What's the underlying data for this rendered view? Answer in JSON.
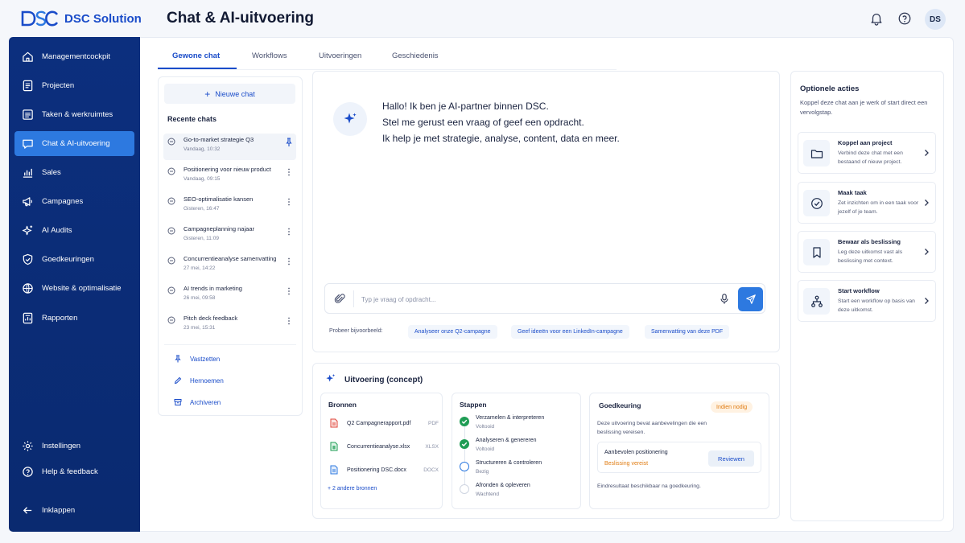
{
  "brand": {
    "logo_text": "DSC Solution",
    "accent": "#1a4cc9",
    "sidebar_bg": "#0c2f7e",
    "active_bg": "#2d79e0"
  },
  "header": {
    "title": "Chat & AI-uitvoering",
    "avatar_initials": "DS"
  },
  "sidebar": {
    "items": [
      {
        "label": "Managementcockpit",
        "icon": "home-icon"
      },
      {
        "label": "Projecten",
        "icon": "document-icon"
      },
      {
        "label": "Taken & werkruimtes",
        "icon": "list-icon"
      },
      {
        "label": "Chat & AI-uitvoering",
        "icon": "chat-icon",
        "active": true
      },
      {
        "label": "Sales",
        "icon": "bar-chart-icon"
      },
      {
        "label": "Campagnes",
        "icon": "megaphone-icon"
      },
      {
        "label": "AI Audits",
        "icon": "sparkle-icon"
      },
      {
        "label": "Goedkeuringen",
        "icon": "shield-check-icon"
      },
      {
        "label": "Website & optimalisatie",
        "icon": "globe-icon"
      },
      {
        "label": "Rapporten",
        "icon": "report-icon"
      }
    ],
    "bottom": [
      {
        "label": "Instellingen",
        "icon": "gear-icon"
      },
      {
        "label": "Help & feedback",
        "icon": "help-icon"
      },
      {
        "label": "Inklappen",
        "icon": "arrow-left-icon"
      }
    ]
  },
  "tabs": [
    {
      "label": "Gewone chat",
      "active": true
    },
    {
      "label": "Workflows"
    },
    {
      "label": "Uitvoeringen"
    },
    {
      "label": "Geschiedenis"
    }
  ],
  "chats": {
    "new_chat": "Nieuwe chat",
    "recent_title": "Recente chats",
    "items": [
      {
        "title": "Go-to-market strategie Q3",
        "time": "Vandaag, 10:32",
        "pinned": true
      },
      {
        "title": "Positionering voor nieuw product",
        "time": "Vandaag, 09:15"
      },
      {
        "title": "SEO-optimalisatie kansen",
        "time": "Gisteren, 16:47"
      },
      {
        "title": "Campagneplanning najaar",
        "time": "Gisteren, 11:09"
      },
      {
        "title": "Concurrentieanalyse samenvatting",
        "time": "27 mei, 14:22"
      },
      {
        "title": "AI trends in marketing",
        "time": "26 mei, 09:58"
      },
      {
        "title": "Pitch deck feedback",
        "time": "23 mei, 15:31"
      }
    ],
    "actions": [
      {
        "label": "Vastzetten",
        "icon": "pin-icon"
      },
      {
        "label": "Hernoemen",
        "icon": "pencil-icon"
      },
      {
        "label": "Archiveren",
        "icon": "archive-icon"
      }
    ]
  },
  "conversation": {
    "greeting": [
      "Hallo! Ik ben je AI-partner binnen DSC.",
      "Stel me gerust een vraag of geef een opdracht.",
      "Ik help je met strategie, analyse, content, data en meer."
    ],
    "input_placeholder": "Typ je vraag of opdracht...",
    "suggest_label": "Probeer bijvoorbeeld:",
    "suggestions": [
      "Analyseer onze Q2-campagne",
      "Geef ideeën voor een LinkedIn-campagne",
      "Samenvatting van deze PDF"
    ]
  },
  "execution": {
    "title": "Uitvoering (concept)",
    "sources": {
      "title": "Bronnen",
      "files": [
        {
          "name": "Q2 Campagnerapport.pdf",
          "ext": "PDF",
          "color": "#e0473c"
        },
        {
          "name": "Concurrentieanalyse.xlsx",
          "ext": "XLSX",
          "color": "#1f9d55"
        },
        {
          "name": "Positionering DSC.docx",
          "ext": "DOCX",
          "color": "#2d79e0"
        }
      ],
      "more": "+ 2 andere bronnen"
    },
    "steps": {
      "title": "Stappen",
      "items": [
        {
          "title": "Verzamelen & interpreteren",
          "status": "Voltooid",
          "state": "done"
        },
        {
          "title": "Analyseren & genereren",
          "status": "Voltooid",
          "state": "done"
        },
        {
          "title": "Structureren & controleren",
          "status": "Bezig",
          "state": "active"
        },
        {
          "title": "Afronden & opleveren",
          "status": "Wachtend",
          "state": "pending"
        }
      ]
    },
    "approval": {
      "title": "Goedkeuring",
      "badge": "Indien nodig",
      "desc": "Deze uitvoering bevat aanbevelingen die een beslissing vereisen.",
      "item_title": "Aanbevolen positionering",
      "item_status": "Beslissing vereist",
      "button": "Reviewen",
      "footer": "Eindresultaat beschikbaar na goedkeuring."
    }
  },
  "optional": {
    "title": "Optionele acties",
    "subtitle": "Koppel deze chat aan je werk of start direct een vervolgstap.",
    "items": [
      {
        "title": "Koppel aan project",
        "desc": "Verbind deze chat met een bestaand of nieuw project.",
        "icon": "folder-icon"
      },
      {
        "title": "Maak taak",
        "desc": "Zet inzichten om in een taak voor jezelf of je team.",
        "icon": "check-circle-icon"
      },
      {
        "title": "Bewaar als beslissing",
        "desc": "Leg deze uitkomst vast als beslissing met context.",
        "icon": "bookmark-icon"
      },
      {
        "title": "Start workflow",
        "desc": "Start een workflow op basis van deze uitkomst.",
        "icon": "workflow-icon"
      }
    ]
  }
}
